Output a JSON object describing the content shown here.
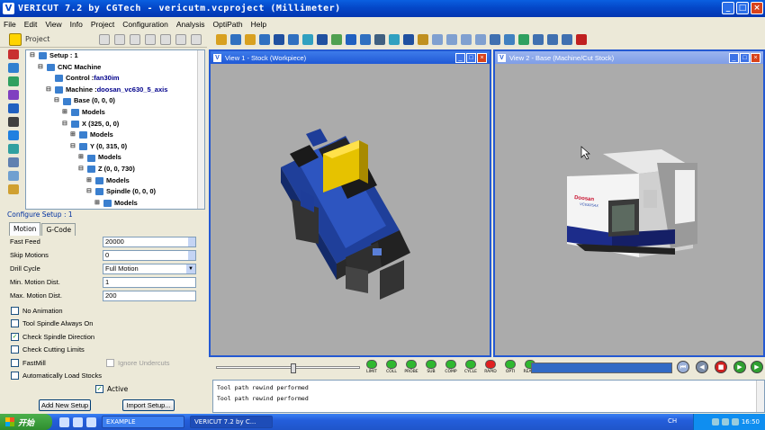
{
  "window": {
    "title": "VERICUT 7.2 by CGTech - vericutm.vcproject (Millimeter)",
    "app_icon": "V"
  },
  "menu": [
    "File",
    "Edit",
    "View",
    "Info",
    "Project",
    "Configuration",
    "Analysis",
    "OptiPath",
    "Help"
  ],
  "project": {
    "label": "Project",
    "tree": [
      {
        "label": "Setup : 1",
        "value": "",
        "indent": 0,
        "exp": "-"
      },
      {
        "label": "CNC Machine",
        "value": "",
        "indent": 1,
        "exp": "-"
      },
      {
        "label": "Control : ",
        "value": "fan30im",
        "indent": 2,
        "exp": ""
      },
      {
        "label": "Machine : ",
        "value": "doosan_vc630_5_axis",
        "indent": 2,
        "exp": "-"
      },
      {
        "label": "Base (0, 0, 0)",
        "value": "",
        "indent": 3,
        "exp": "-"
      },
      {
        "label": "Models",
        "value": "",
        "indent": 4,
        "exp": "+"
      },
      {
        "label": "X (325, 0, 0)",
        "value": "",
        "indent": 4,
        "exp": "-"
      },
      {
        "label": "Models",
        "value": "",
        "indent": 5,
        "exp": "+"
      },
      {
        "label": "Y (0, 315, 0)",
        "value": "",
        "indent": 5,
        "exp": "-"
      },
      {
        "label": "Models",
        "value": "",
        "indent": 6,
        "exp": "+"
      },
      {
        "label": "Z (0, 0, 730)",
        "value": "",
        "indent": 6,
        "exp": "-"
      },
      {
        "label": "Models",
        "value": "",
        "indent": 7,
        "exp": "+"
      },
      {
        "label": "Spindle (0, 0, 0)",
        "value": "",
        "indent": 7,
        "exp": "-"
      },
      {
        "label": "Models",
        "value": "",
        "indent": 8,
        "exp": "+"
      }
    ]
  },
  "configure": {
    "heading": "Configure Setup : 1",
    "tabs": [
      "Motion",
      "G-Code"
    ],
    "fields": [
      {
        "label": "Fast Feed",
        "value": "20000",
        "kind": "spin"
      },
      {
        "label": "Skip Motions",
        "value": "0",
        "kind": "spin"
      },
      {
        "label": "Drill Cycle",
        "value": "Full Motion",
        "kind": "dropdown"
      },
      {
        "label": "Min. Motion Dist.",
        "value": "1",
        "kind": "text"
      },
      {
        "label": "Max. Motion Dist.",
        "value": "200",
        "kind": "text"
      }
    ],
    "checks": [
      {
        "label": "No Animation",
        "checked": false
      },
      {
        "label": "Tool Spindle Always On",
        "checked": false
      },
      {
        "label": "Check Spindle Direction",
        "checked": true
      },
      {
        "label": "Check Cutting Limits",
        "checked": false
      },
      {
        "label": "FastMill",
        "checked": false,
        "extra": "Ignore Undercuts"
      },
      {
        "label": "Automatically Load Stocks",
        "checked": false
      }
    ],
    "active_label": "Active",
    "add_button": "Add New Setup",
    "import_button": "Import Setup..."
  },
  "views": [
    {
      "title": "View 1 - Stock (Workpiece)"
    },
    {
      "title": "View 2 - Base (Machine/Cut Stock)"
    }
  ],
  "machine_brand": "Doosan",
  "machine_model": "VC630/5AX",
  "status_leds": [
    {
      "label": "LIMIT",
      "color": "#2fb82f"
    },
    {
      "label": "COLL",
      "color": "#2fb82f"
    },
    {
      "label": "PROBE",
      "color": "#2fb82f"
    },
    {
      "label": "SUB",
      "color": "#2fb82f"
    },
    {
      "label": "COMP",
      "color": "#2fb82f"
    },
    {
      "label": "CYCLE",
      "color": "#2fb82f"
    },
    {
      "label": "RAPID",
      "color": "#e02020"
    },
    {
      "label": "OPTI",
      "color": "#2fb82f"
    },
    {
      "label": "READY",
      "color": "#2fb82f"
    }
  ],
  "log": [
    "Tool path rewind performed",
    "Tool path rewind performed"
  ],
  "taskbar": {
    "start": "开始",
    "tasks": [
      "EXAMPLE",
      "VERICUT 7.2 by C..."
    ],
    "lang": "CH",
    "clock": "16:50"
  }
}
